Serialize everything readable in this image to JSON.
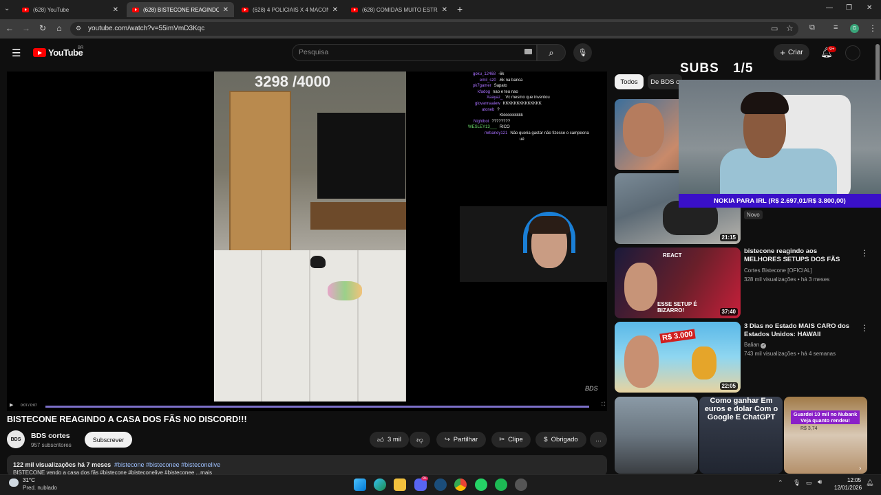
{
  "browser": {
    "tabs": [
      {
        "title": "(628) YouTube",
        "active": false
      },
      {
        "title": "(628) BISTECONE REAGINDO A",
        "active": true
      },
      {
        "title": "(628) 4 POLICIAIS X 4 MACONH",
        "active": false
      },
      {
        "title": "(628) COMIDAS MUITO ESTRAN",
        "active": false
      }
    ],
    "new_tab": "+",
    "url": "youtube.com/watch?v=55imVmD3Kqc"
  },
  "youtube": {
    "logo_text": "YouTube",
    "region": "BR",
    "search_placeholder": "Pesquisa",
    "create_label": "Criar",
    "notifications_badge": "9+"
  },
  "player": {
    "score": "3298 /4000",
    "timecode": "0:07 / 0:07",
    "watermark": "BDS",
    "progress": 1.0,
    "chat": [
      {
        "user": "goku_12468",
        "msg": "-6k"
      },
      {
        "user": "emil_sz0",
        "msg": "-6k na banca"
      },
      {
        "user": "pk7gamer",
        "msg": "Sapato"
      },
      {
        "user": "kfadog",
        "msg": "nao e teu nao"
      },
      {
        "user": "Xaayaz_",
        "msg": "Vc mesmo que inventou"
      },
      {
        "user": "giovannaaiew",
        "msg": "KKKKKKKKKKKKKK"
      },
      {
        "user": "atoneb",
        "msg": "?"
      },
      {
        "user": "",
        "msg": "Kkkkkkkkkkk"
      },
      {
        "user": "Nightbot",
        "msg": "????????"
      },
      {
        "user": "WESLEY13___",
        "msg": "RICO"
      },
      {
        "user": "mrbaney121",
        "msg": "Não queria gastar não fizesse o campeona"
      },
      {
        "user": "",
        "msg": "ué"
      }
    ]
  },
  "video": {
    "title": "BISTECONE REAGINDO A CASA DOS FÃS NO DISCORD!!!",
    "channel": "BDS cortes",
    "channel_avatar_text": "BDS",
    "subscribers": "957 subscritores",
    "subscribe_label": "Subscrever",
    "likes": "3 mil",
    "share_label": "Partilhar",
    "clip_label": "Clipe",
    "thanks_label": "Obrigado",
    "more_label": "…",
    "stats": "122 mil visualizações  há 7 meses",
    "tags": "#bistecone #bisteconee #bisteconelive",
    "desc_line": "BISTECONE vendo a casa dos fãs #bistecone #bisteconelive #bisteconee ...mais"
  },
  "sidebar": {
    "chips": [
      "Todos",
      "De BDS c"
    ],
    "new_badge": "Novo",
    "videos": [
      {
        "duration": "",
        "title": "",
        "channel": "",
        "meta": ""
      },
      {
        "duration": "21:15",
        "title": "",
        "channel": "",
        "meta": ""
      },
      {
        "duration": "37:40",
        "title": "bistecone reagindo aos MELHORES SETUPS DOS FÃS",
        "channel": "Cortes Bistecone [OFICIAL]",
        "meta": "328 mil visualizações • há 3 meses",
        "thumb_text1": "REACT",
        "thumb_text2": "ESSE SETUP É BIZARRO!"
      },
      {
        "duration": "22:05",
        "title": "3 Dias no Estado MAIS CARO dos Estados Unidos: HAWAII",
        "channel": "Balian",
        "meta": "743 mil visualizações • há 4 semanas",
        "thumb_text1": "R$ 3.000"
      }
    ],
    "shorts": [
      {
        "text": ""
      },
      {
        "text": "Como ganhar Em euros e dolar Com o Google E ChatGPT"
      },
      {
        "text": "Guardei 10 mil no Nubank Veja quanto rendeu!",
        "sub": "R$ 3,74"
      }
    ]
  },
  "overlay": {
    "subs_label": "SUBS",
    "subs_value": "1/5",
    "goal_text": "NOKIA PARA IRL (R$ 2.697,01/R$ 3.800,00)"
  },
  "taskbar": {
    "temp": "31°C",
    "weather": "Pred. nublado",
    "time": "12:05",
    "date": "12/01/2026",
    "discord_badge": "9+"
  },
  "colors": {
    "accent": "#ff0000",
    "overlay_bar": "#3a10c8",
    "progress": "#7c70c9"
  }
}
